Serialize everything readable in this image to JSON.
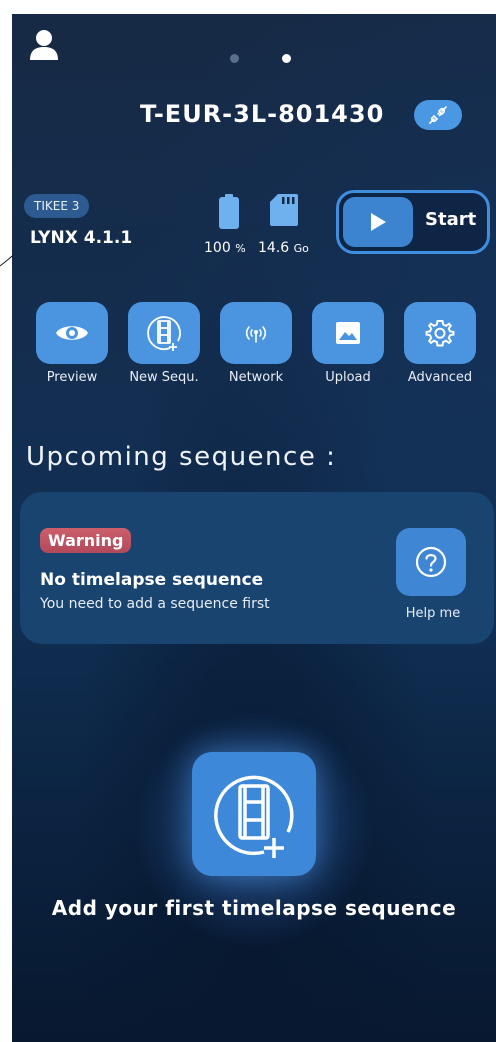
{
  "header": {
    "user_icon": "user-icon",
    "pager": {
      "count": 2,
      "active_index": 1
    },
    "device_name": "T-EUR-3L-801430",
    "link_icon": "link-icon"
  },
  "device": {
    "model_tag": "TIKEE 3",
    "firmware": "LYNX 4.1.1",
    "battery": {
      "value": "100",
      "unit": "%",
      "icon": "battery-icon"
    },
    "storage": {
      "value": "14.6",
      "unit": "Go",
      "icon": "sd-card-icon"
    }
  },
  "start": {
    "label": "Start",
    "icon": "play-icon"
  },
  "actions": [
    {
      "label": "Preview",
      "icon": "eye-icon"
    },
    {
      "label": "New Sequ.",
      "icon": "film-add-icon"
    },
    {
      "label": "Network",
      "icon": "wifi-signal-icon"
    },
    {
      "label": "Upload",
      "icon": "image-icon"
    },
    {
      "label": "Advanced",
      "icon": "gear-icon"
    }
  ],
  "upcoming": {
    "title": "Upcoming sequence :",
    "badge": "Warning",
    "heading": "No timelapse sequence",
    "message": "You need to add a sequence first",
    "help_label": "Help me",
    "help_icon": "question-icon"
  },
  "add_sequence": {
    "label": "Add your first timelapse sequence",
    "icon": "film-add-icon"
  },
  "colors": {
    "accent": "#4b95e0",
    "warning": "#c4535f",
    "background": "#132b4b"
  }
}
